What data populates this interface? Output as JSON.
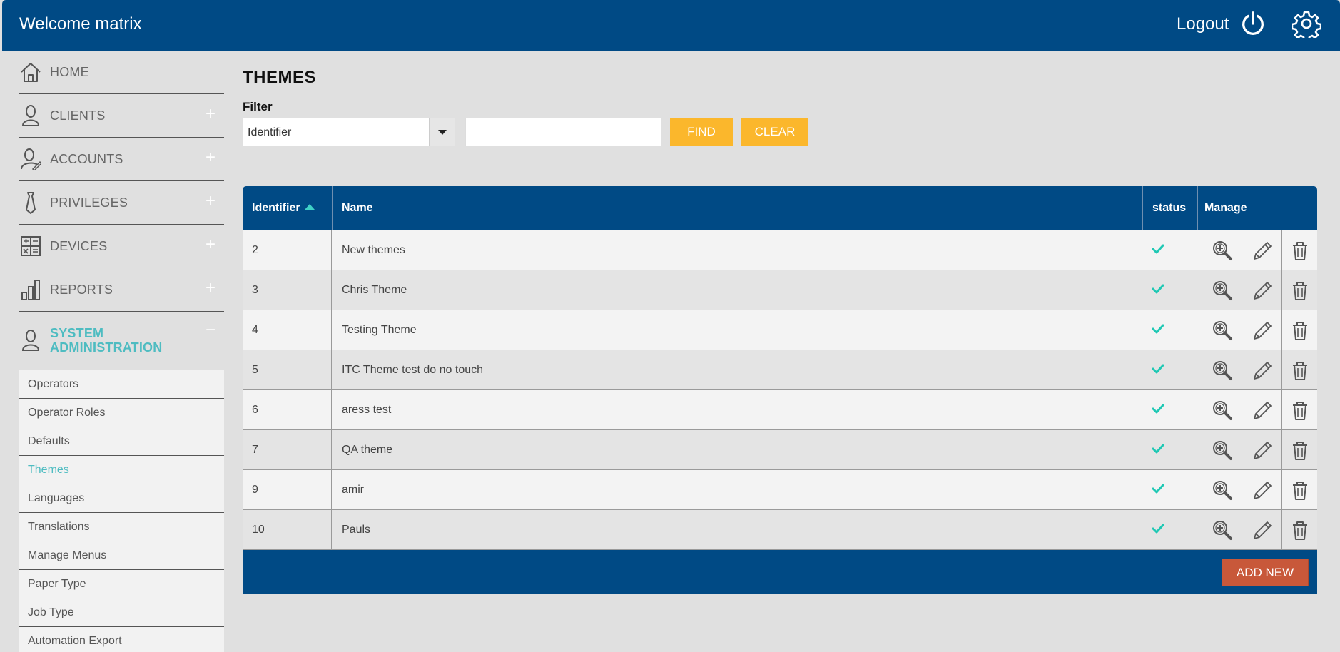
{
  "header": {
    "welcome": "Welcome matrix",
    "logout": "Logout",
    "power_icon": "power-icon",
    "settings_icon": "gear-icon",
    "bg_color": "#004a85"
  },
  "sidebar": {
    "items": [
      {
        "label": "HOME",
        "icon": "home-icon",
        "expand": ""
      },
      {
        "label": "CLIENTS",
        "icon": "user-icon",
        "expand": "+"
      },
      {
        "label": "ACCOUNTS",
        "icon": "user-edit-icon",
        "expand": "+"
      },
      {
        "label": "PRIVILEGES",
        "icon": "tie-icon",
        "expand": "+"
      },
      {
        "label": "DEVICES",
        "icon": "calculator-icon",
        "expand": "+"
      },
      {
        "label": "REPORTS",
        "icon": "bar-chart-icon",
        "expand": "+"
      },
      {
        "label": "SYSTEM\nADMINISTRATION",
        "icon": "user-icon",
        "expand": "−"
      }
    ],
    "sub_items": [
      "Operators",
      "Operator Roles",
      "Defaults",
      "Themes",
      "Languages",
      "Translations",
      "Manage Menus",
      "Paper Type",
      "Job Type",
      "Automation Export"
    ],
    "active_sub": "Themes",
    "active_color": "#4ebcc1"
  },
  "main": {
    "title": "THEMES",
    "filter_label": "Filter",
    "filter_select_value": "Identifier",
    "filter_text_value": "",
    "find_label": "FIND",
    "clear_label": "CLEAR",
    "button_color": "#fbb72c"
  },
  "table": {
    "columns": {
      "identifier": "Identifier",
      "name": "Name",
      "status": "status",
      "manage": "Manage"
    },
    "sort": "identifier ascending",
    "rows": [
      {
        "id": "2",
        "name": "New themes",
        "status": "active"
      },
      {
        "id": "3",
        "name": "Chris Theme",
        "status": "active"
      },
      {
        "id": "4",
        "name": "Testing Theme",
        "status": "active"
      },
      {
        "id": "5",
        "name": "ITC Theme test do no touch",
        "status": "active"
      },
      {
        "id": "6",
        "name": "aress test",
        "status": "active"
      },
      {
        "id": "7",
        "name": "QA theme",
        "status": "active"
      },
      {
        "id": "9",
        "name": "amir",
        "status": "active"
      },
      {
        "id": "10",
        "name": "Pauls",
        "status": "active"
      }
    ],
    "row_icons": [
      "check-icon",
      "zoom-in-icon",
      "pencil-icon",
      "trash-icon"
    ],
    "add_new_label": "ADD NEW",
    "add_new_color": "#c8583a"
  }
}
